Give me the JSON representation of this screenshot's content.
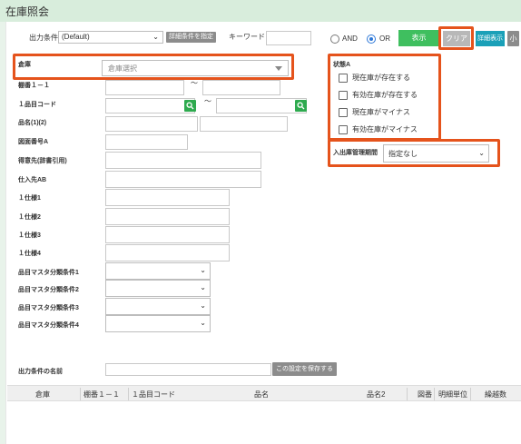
{
  "title": "在庫照会",
  "toolbar": {
    "output_condition_label": "出力条件",
    "output_condition_value": "(Default)",
    "detail_condition_button": "詳細条件を指定",
    "keyword_label": "キーワード",
    "keyword_value": "",
    "and_label": "AND",
    "or_label": "OR",
    "display_button": "表示",
    "clear_button": "クリア",
    "detail_display_button": "詳細表示",
    "small_button": "小"
  },
  "form": {
    "warehouse_label": "倉庫",
    "warehouse_placeholder": "倉庫選択",
    "shelf_label": "棚番１－１",
    "tilde1": "～",
    "item_code_label": "１品目コード",
    "tilde2": "～",
    "item_name_label": "品名(1)(2)",
    "drawing_no_label": "図面番号A",
    "customer_label": "得意先(辞書引用)",
    "supplier_label": "仕入先AB",
    "spec1_label": "１仕様1",
    "spec2_label": "１仕様2",
    "spec3_label": "１仕様3",
    "spec4_label": "１仕様4",
    "master_cond1_label": "品目マスタ分類条件1",
    "master_cond2_label": "品目マスタ分類条件2",
    "master_cond3_label": "品目マスタ分類条件3",
    "master_cond4_label": "品目マスタ分類条件4",
    "save_name_label": "出力条件の名前",
    "save_name_value": "",
    "save_button": "この設定を保存する"
  },
  "status": {
    "title": "状態A",
    "options": [
      "現在庫が存在する",
      "有効在庫が存在する",
      "現在庫がマイナス",
      "有効在庫がマイナス"
    ]
  },
  "period": {
    "label": "入出庫管理期間",
    "value": "指定なし"
  },
  "table": {
    "columns": [
      "倉庫",
      "棚番１－１",
      "１品目コード",
      "品名",
      "品名2",
      "図番",
      "明細単位",
      "繰越数"
    ]
  },
  "colors": {
    "highlight": "#e5531c",
    "display_button": "#3fbf5f",
    "detail_button": "#1aa0b8",
    "title_bar": "#d8eddc"
  }
}
